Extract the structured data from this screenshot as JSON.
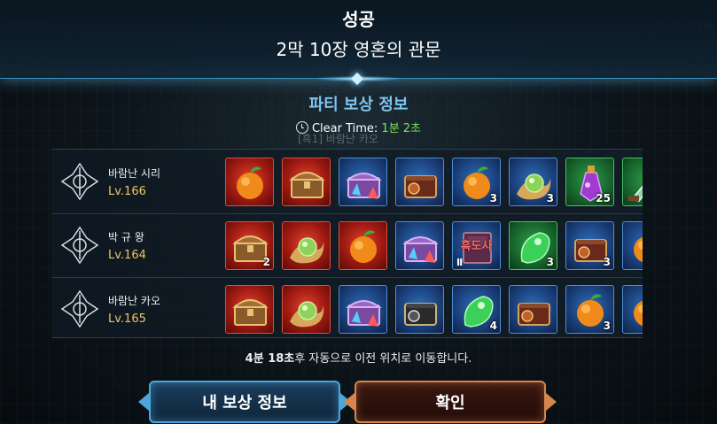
{
  "header": {
    "title": "성공",
    "subtitle": "2막 10장 영혼의 관문"
  },
  "corner_hint": "[흑",
  "section_title": "파티 보상 정보",
  "clear_time": {
    "label": "Clear Time:",
    "value": "1분 2초"
  },
  "ghost_text": "[흑1] 바람난 카오",
  "players": [
    {
      "name": "바람난 시리",
      "level": "Lv.166",
      "items": [
        {
          "icon": "orange-fruit-icon",
          "rarity": "red",
          "count": ""
        },
        {
          "icon": "treasure-chest-icon",
          "rarity": "red",
          "count": ""
        },
        {
          "icon": "crystal-chest-icon",
          "rarity": "blue",
          "count": ""
        },
        {
          "icon": "ornate-chest-icon",
          "rarity": "blue",
          "count": ""
        },
        {
          "icon": "orange-fruit-icon",
          "rarity": "blue",
          "count": "3"
        },
        {
          "icon": "green-orb-icon",
          "rarity": "blue",
          "count": "3"
        },
        {
          "icon": "purple-potion-icon",
          "rarity": "green",
          "count": "25"
        },
        {
          "icon": "blade-icon",
          "rarity": "green",
          "count": ""
        }
      ]
    },
    {
      "name": "박 규 왕",
      "level": "Lv.164",
      "items": [
        {
          "icon": "treasure-chest-icon",
          "rarity": "red",
          "count": "2"
        },
        {
          "icon": "green-orb-icon",
          "rarity": "red",
          "count": ""
        },
        {
          "icon": "orange-fruit-icon",
          "rarity": "red",
          "count": ""
        },
        {
          "icon": "crystal-chest-icon",
          "rarity": "blue",
          "count": ""
        },
        {
          "icon": "skill-book-icon",
          "rarity": "blue",
          "count": ""
        },
        {
          "icon": "green-leaf-icon",
          "rarity": "green",
          "count": "3"
        },
        {
          "icon": "ornate-chest-icon",
          "rarity": "blue",
          "count": "3"
        },
        {
          "icon": "orange-fruit-icon",
          "rarity": "blue",
          "count": ""
        }
      ]
    },
    {
      "name": "바람난 카오",
      "level": "Lv.165",
      "items": [
        {
          "icon": "treasure-chest-icon",
          "rarity": "red",
          "count": ""
        },
        {
          "icon": "green-orb-icon",
          "rarity": "red",
          "count": ""
        },
        {
          "icon": "crystal-chest-icon",
          "rarity": "blue",
          "count": ""
        },
        {
          "icon": "black-chest-icon",
          "rarity": "blue",
          "count": ""
        },
        {
          "icon": "green-leaf-icon",
          "rarity": "blue",
          "count": "4"
        },
        {
          "icon": "ornate-chest-icon",
          "rarity": "blue",
          "count": ""
        },
        {
          "icon": "orange-fruit-icon",
          "rarity": "blue",
          "count": "3"
        },
        {
          "icon": "orange-fruit-icon",
          "rarity": "blue",
          "count": ""
        }
      ]
    }
  ],
  "skill_book_label": "흑도사",
  "skill_book_tier": "Ⅱ",
  "footer": {
    "time": "4분 18초",
    "message": "후 자동으로 이전 위치로 이동합니다."
  },
  "buttons": {
    "my_rewards": "내 보상 정보",
    "confirm": "확인"
  },
  "colors": {
    "accent_blue": "#4ca6dc",
    "accent_orange": "#d6864a",
    "level_gold": "#f2c463",
    "time_green": "#7ee05a"
  }
}
